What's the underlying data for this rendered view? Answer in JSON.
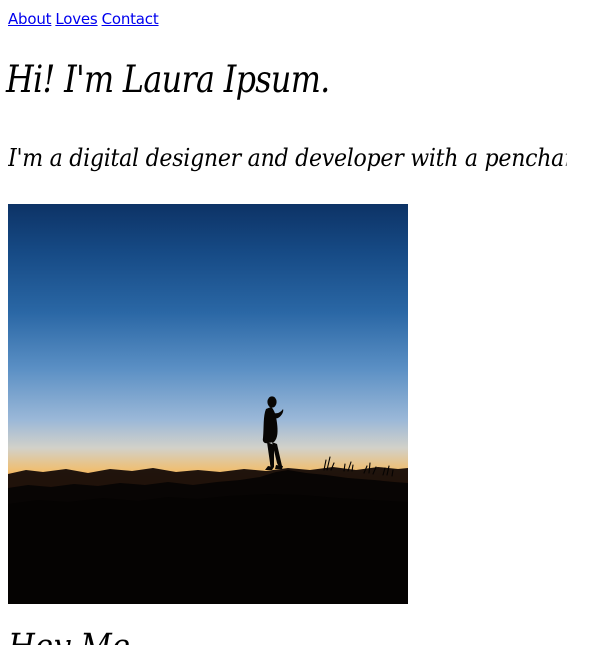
{
  "nav": {
    "items": [
      {
        "label": "About"
      },
      {
        "label": "Loves"
      },
      {
        "label": "Contact"
      }
    ]
  },
  "hero": {
    "title": "Hi! I'm Laura Ipsum.",
    "tagline": "I'm a digital designer and developer with a penchant for gourmet d"
  },
  "section": {
    "heading": "Hey Me"
  },
  "photo": {
    "colors": {
      "sky_top": "#0d3366",
      "sky_mid": "#5a8fc4",
      "horizon": "#f49a3b",
      "ground": "#050403"
    }
  }
}
